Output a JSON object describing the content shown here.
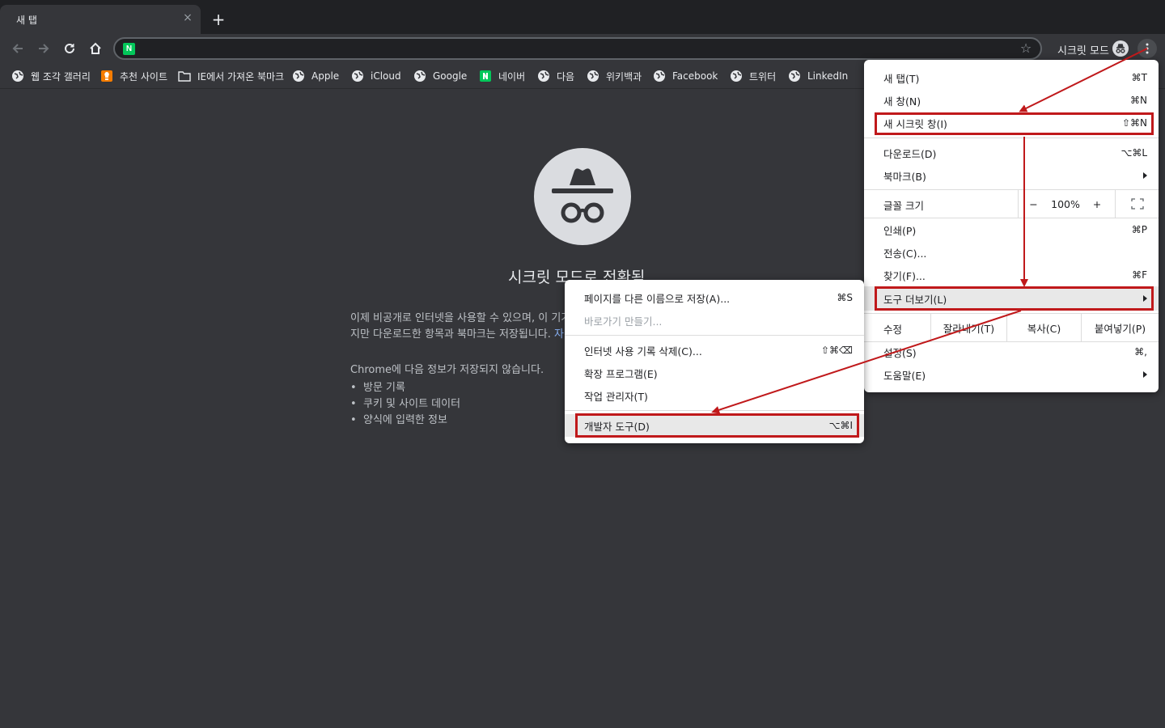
{
  "tab": {
    "title": "새 탭",
    "close": "×",
    "new_tab": "+"
  },
  "toolbar": {
    "address_value": "",
    "site_badge": "N",
    "incognito_label": "시크릿 모드"
  },
  "bookmarks": [
    {
      "label": "웹 조각 갤러리",
      "icon": "globe-icon"
    },
    {
      "label": "추천 사이트",
      "icon": "lightbulb-icon"
    },
    {
      "label": "IE에서 가져온 북마크",
      "icon": "folder-icon"
    },
    {
      "label": "Apple",
      "icon": "globe-icon"
    },
    {
      "label": "iCloud",
      "icon": "globe-icon"
    },
    {
      "label": "Google",
      "icon": "globe-icon"
    },
    {
      "label": "네이버",
      "icon": "naver-icon"
    },
    {
      "label": "다음",
      "icon": "globe-icon"
    },
    {
      "label": "위키백과",
      "icon": "globe-icon"
    },
    {
      "label": "Facebook",
      "icon": "globe-icon"
    },
    {
      "label": "트위터",
      "icon": "globe-icon"
    },
    {
      "label": "LinkedIn",
      "icon": "globe-icon"
    }
  ],
  "incognito_page": {
    "title": "시크릿 모드로 전환됨",
    "line1": "이제 비공개로 인터넷을 사용할 수 있으며, 이 기기",
    "line2_text": "지만 다운로드한 항목과 북마크는 저장됩니다.",
    "line2_link": "자",
    "not_saved_heading": "Chrome에 다음 정보가 저장되지 않습니다.",
    "not_saved_items": [
      "방문 기록",
      "쿠키 및 사이트 데이터",
      "양식에 입력한 정보"
    ]
  },
  "main_menu": {
    "items": [
      {
        "label": "새 탭(T)",
        "shortcut": "⌘T"
      },
      {
        "label": "새 창(N)",
        "shortcut": "⌘N"
      },
      {
        "label": "새 시크릿 창(I)",
        "shortcut": "⇧⌘N"
      },
      {
        "label": "다운로드(D)",
        "shortcut": "⌥⌘L"
      },
      {
        "label": "북마크(B)",
        "shortcut": ""
      },
      {
        "label": "인쇄(P)",
        "shortcut": "⌘P"
      },
      {
        "label": "전송(C)...",
        "shortcut": ""
      },
      {
        "label": "찾기(F)...",
        "shortcut": "⌘F"
      },
      {
        "label": "도구 더보기(L)",
        "shortcut": ""
      },
      {
        "label": "설정(S)",
        "shortcut": "⌘,"
      },
      {
        "label": "도움말(E)",
        "shortcut": ""
      }
    ],
    "zoom": {
      "label": "글꼴 크기",
      "minus": "−",
      "value": "100%",
      "plus": "+"
    },
    "edit": {
      "label": "수정",
      "cut": "잘라내기(T)",
      "copy": "복사(C)",
      "paste": "붙여넣기(P)"
    }
  },
  "submenu": {
    "items": [
      {
        "label": "페이지를 다른 이름으로 저장(A)...",
        "shortcut": "⌘S",
        "disabled": false
      },
      {
        "label": "바로가기 만들기...",
        "shortcut": "",
        "disabled": true
      },
      {
        "label": "인터넷 사용 기록 삭제(C)...",
        "shortcut": "⇧⌘⌫",
        "disabled": false
      },
      {
        "label": "확장 프로그램(E)",
        "shortcut": "",
        "disabled": false
      },
      {
        "label": "작업 관리자(T)",
        "shortcut": "",
        "disabled": false
      },
      {
        "label": "개발자 도구(D)",
        "shortcut": "⌥⌘I",
        "disabled": false
      }
    ]
  },
  "annotation_color": "#c0191b"
}
